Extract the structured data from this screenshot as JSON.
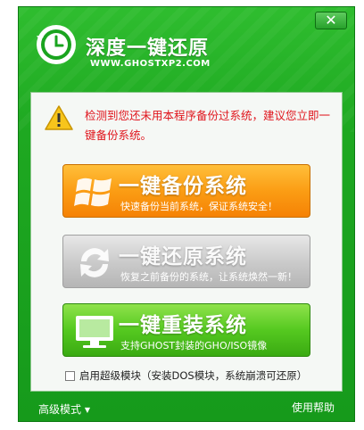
{
  "header": {
    "title": "深度一键还原",
    "subtitle": "WWW.GHOSTXP2.COM",
    "close_symbol": "✕"
  },
  "warning": {
    "icon": "warning-icon",
    "text": "检测到您还未用本程序备份过系统，建议您立即一键备份系统。"
  },
  "actions": [
    {
      "title": "一键备份系统",
      "description": "快速备份当前系统，保证系统安全！",
      "icon": "windows-flag-icon"
    },
    {
      "title": "一键还原系统",
      "description": "恢复之前备份的系统，让系统焕然一新！",
      "icon": "refresh-arrows-icon"
    },
    {
      "title": "一键重装系统",
      "description": "支持GHOST封装的GHO/ISO镜像",
      "icon": "monitor-icon"
    }
  ],
  "option": {
    "label": "启用超级模块（安装DOS模块，系统崩溃可还原）",
    "checked": false
  },
  "footer": {
    "advanced_mode": "高级模式",
    "dropdown_symbol": "▼",
    "help": "使用帮助"
  },
  "colors": {
    "window_green": "#1ea821",
    "warning_red": "#e0141c",
    "backup_orange": "#fb9d14",
    "restore_gray": "#c9c9c9",
    "reinstall_green": "#55c920"
  }
}
